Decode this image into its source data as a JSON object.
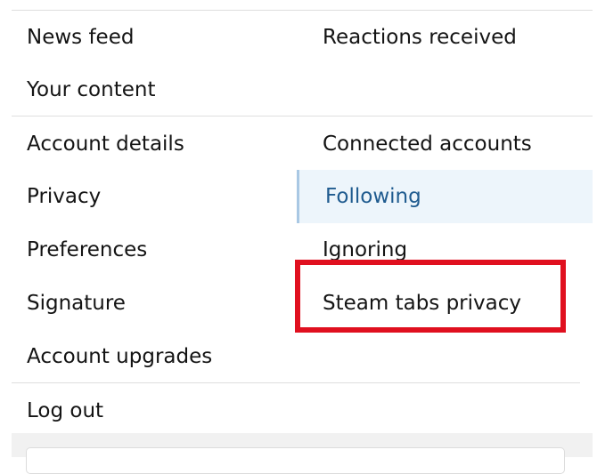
{
  "menu": {
    "group1_left": [
      "News feed",
      "Your content"
    ],
    "group1_right": [
      "Reactions received"
    ],
    "group2_left": [
      "Account details",
      "Privacy",
      "Preferences",
      "Signature",
      "Account upgrades"
    ],
    "group2_right": [
      "Connected accounts",
      "Following",
      "Ignoring",
      "Steam tabs privacy"
    ],
    "group3": [
      "Log out"
    ],
    "selected_item": "Following"
  },
  "colors": {
    "highlight_border": "#e0101f",
    "selected_text": "#1f5b8f",
    "selected_background": "#edf5fb",
    "selected_accent": "#a9c8e4"
  }
}
